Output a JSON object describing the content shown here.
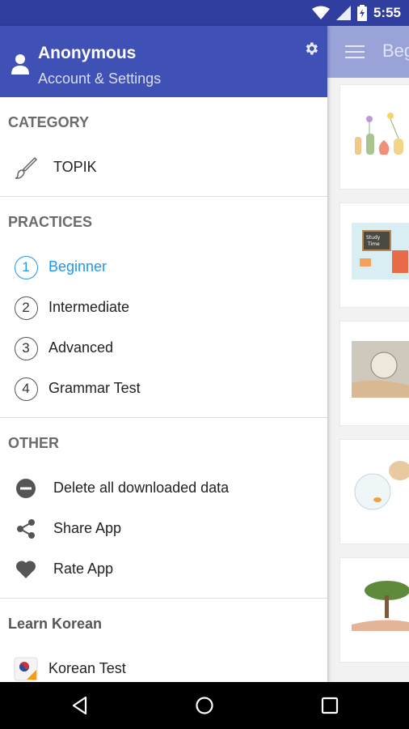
{
  "status_bar": {
    "time": "5:55"
  },
  "background": {
    "toolbar_title": "Beg"
  },
  "drawer": {
    "header": {
      "name": "Anonymous",
      "subtitle": "Account & Settings"
    },
    "sections": {
      "category": {
        "title": "CATEGORY",
        "items": [
          {
            "label": "TOPIK",
            "icon": "brush-icon"
          }
        ]
      },
      "practices": {
        "title": "PRACTICES",
        "items": [
          {
            "number": "1",
            "label": "Beginner",
            "active": true
          },
          {
            "number": "2",
            "label": "Intermediate"
          },
          {
            "number": "3",
            "label": "Advanced"
          },
          {
            "number": "4",
            "label": "Grammar Test"
          }
        ]
      },
      "other": {
        "title": "OTHER",
        "items": [
          {
            "label": "Delete all downloaded data",
            "icon": "remove-circle-icon"
          },
          {
            "label": "Share App",
            "icon": "share-icon"
          },
          {
            "label": "Rate App",
            "icon": "heart-icon"
          }
        ]
      },
      "learn": {
        "title": "Learn Korean",
        "items": [
          {
            "label": "Korean Test",
            "icon": "korean-flag-icon"
          }
        ]
      }
    }
  },
  "colors": {
    "primary": "#3f51b5",
    "status_bar": "#303f9f",
    "accent": "#2196f3"
  }
}
